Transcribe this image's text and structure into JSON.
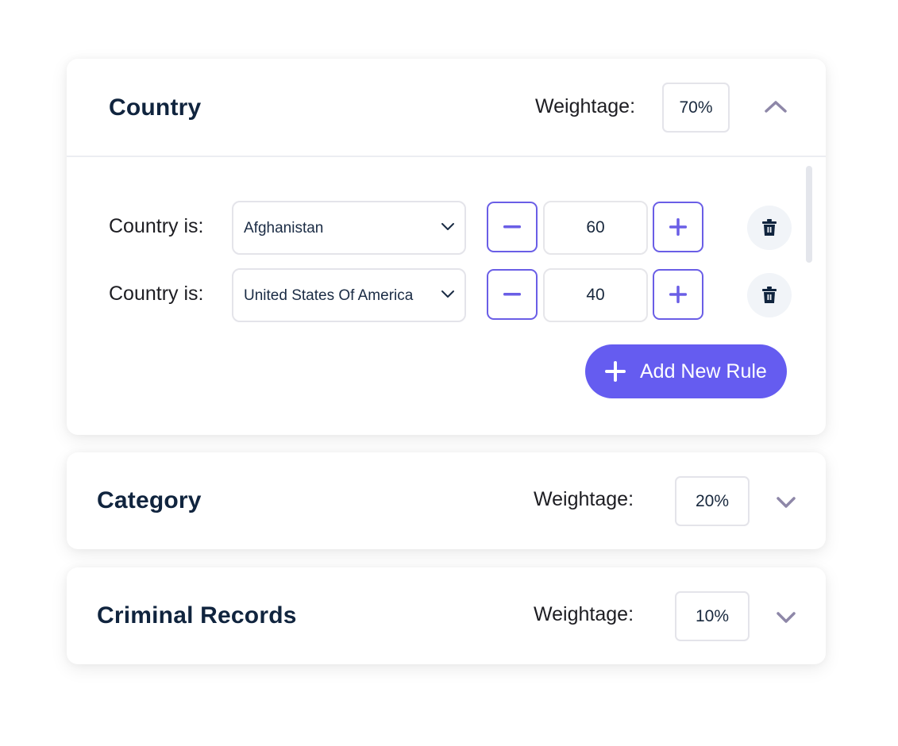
{
  "colors": {
    "accent": "#655cf0",
    "stepper_border": "#6a5ee6",
    "title": "#10243e",
    "chevron": "#8e87a8",
    "trash_bg": "#f1f4f8"
  },
  "sections": [
    {
      "title": "Country",
      "weightage_label": "Weightage:",
      "weightage_value": "70%",
      "expanded": true,
      "toggle_icon": "chevron-up-icon",
      "rules": [
        {
          "label": "Country is:",
          "selected_country": "Afghanistan",
          "value": "60",
          "minus": "−",
          "plus": "+"
        },
        {
          "label": "Country is:",
          "selected_country": "United States Of America",
          "value": "40",
          "minus": "−",
          "plus": "+"
        }
      ],
      "add_rule_label": "Add New Rule"
    },
    {
      "title": "Category",
      "weightage_label": "Weightage:",
      "weightage_value": "20%",
      "expanded": false,
      "toggle_icon": "chevron-down-icon"
    },
    {
      "title": "Criminal Records",
      "weightage_label": "Weightage:",
      "weightage_value": "10%",
      "expanded": false,
      "toggle_icon": "chevron-down-icon"
    }
  ]
}
